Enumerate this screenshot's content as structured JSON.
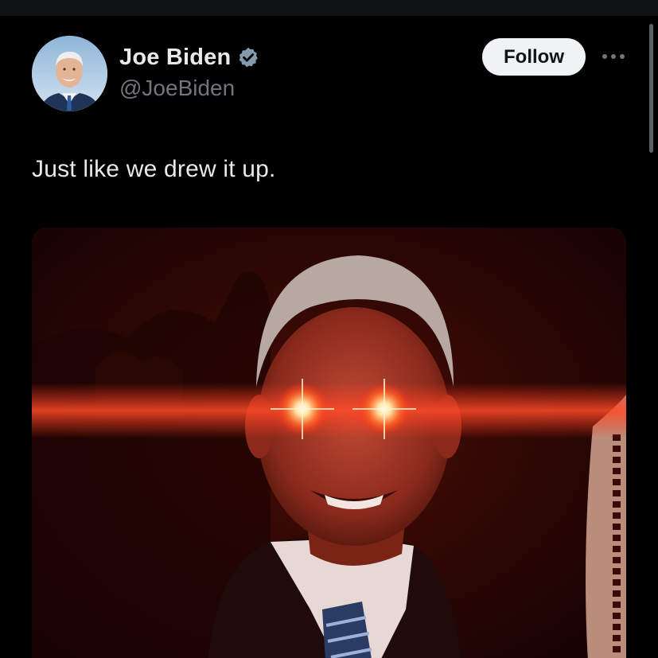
{
  "post": {
    "author": {
      "display_name": "Joe Biden",
      "handle": "@JoeBiden",
      "verified": true,
      "avatar_icon": "profile-photo"
    },
    "follow_label": "Follow",
    "more_icon": "more-horizontal-icon",
    "text": "Just like we drew it up.",
    "media": {
      "kind": "photo",
      "icon": "edited-portrait-image"
    }
  },
  "colors": {
    "background": "#000000",
    "text_primary": "#e7e9ea",
    "text_secondary": "#71767b",
    "follow_button_bg": "#eff3f4",
    "verified_badge": "#829aab",
    "eye_glow": "#ff3a1e"
  }
}
